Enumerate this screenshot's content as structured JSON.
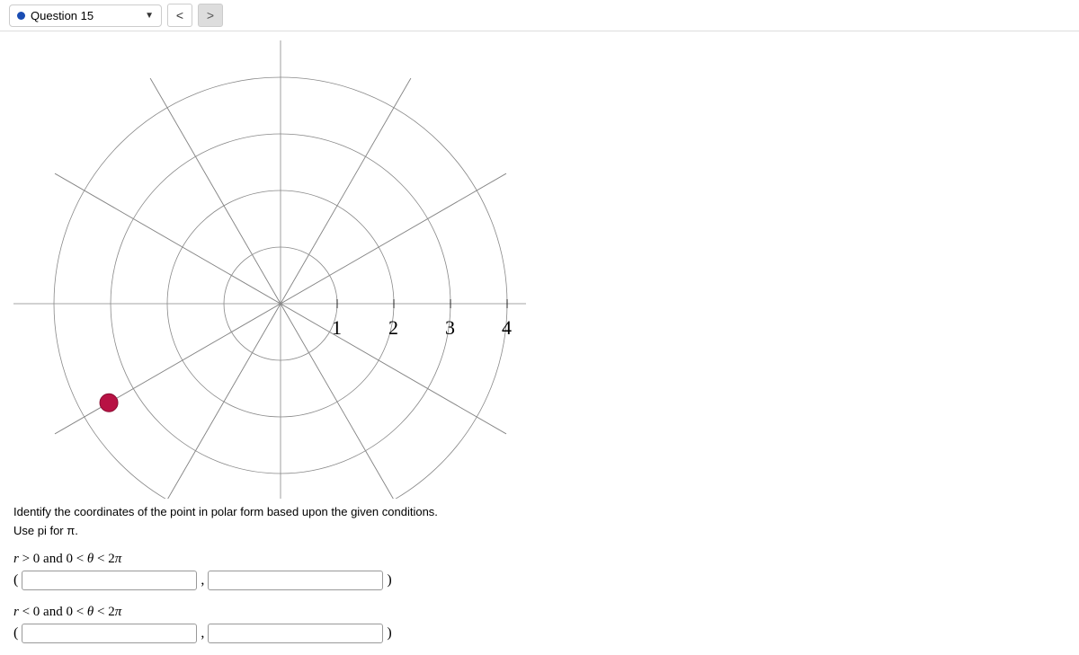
{
  "toolbar": {
    "question_label": "Question 15",
    "prev": "<",
    "next": ">"
  },
  "prompt": {
    "line1": "Identify the coordinates of the point in polar form based upon the given conditions.",
    "line2": "Use pi for π."
  },
  "answers": {
    "cond1": "r > 0 and 0 < θ < 2π",
    "cond2": "r < 0 and 0 < θ < 2π",
    "lparen": "(",
    "comma": ",",
    "rparen": ")"
  },
  "chart_data": {
    "type": "polar",
    "title": "",
    "r_ticks": [
      1,
      2,
      3,
      4
    ],
    "r_max": 4,
    "angle_divisions": 12,
    "point": {
      "r": 3.5,
      "theta_deg": 210
    },
    "point_approx_note": "Point appears at roughly r=3.5 on the 210° ray (7π/6)",
    "axis_tick_labels": [
      "1",
      "2",
      "3",
      "4"
    ]
  }
}
